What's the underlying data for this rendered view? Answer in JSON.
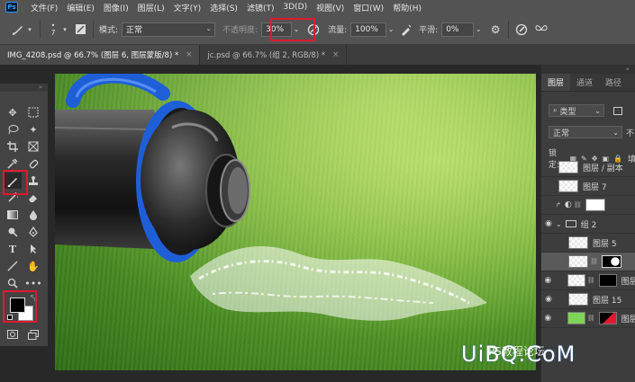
{
  "menubar": {
    "logo": "Ps",
    "items": [
      "文件(F)",
      "编辑(E)",
      "图像(I)",
      "图层(L)",
      "文字(Y)",
      "选择(S)",
      "滤镜(T)",
      "3D(D)",
      "视图(V)",
      "窗口(W)",
      "帮助(H)"
    ]
  },
  "options": {
    "brush_size": "7",
    "mode_label": "模式:",
    "mode_value": "正常",
    "opacity_label": "不透明度:",
    "opacity_value": "30%",
    "flow_label": "流量:",
    "flow_value": "100%",
    "smoothing_label": "平滑:",
    "smoothing_value": "0%"
  },
  "tabs": [
    {
      "title": "IMG_4208.psd @ 66.7% (图层 6, 图层蒙版/8) *",
      "close": "×"
    },
    {
      "title": "jc.psd @ 66.7% (组 2, RGB/8) *",
      "close": "×"
    }
  ],
  "toolbar": {
    "collapse": "»"
  },
  "panel": {
    "collapse": "»",
    "tabs": [
      "图层",
      "通道",
      "路径"
    ],
    "filter_value": "类型",
    "blend_value": "正常",
    "opacity_short": "不",
    "lock_label": "锁定:",
    "fill_short": "填",
    "layers": [
      {
        "name": "图层 / 副本"
      },
      {
        "name": "图层 7"
      },
      {
        "name": ""
      },
      {
        "name": "组 2"
      },
      {
        "name": "图层 5"
      },
      {
        "name": ""
      },
      {
        "name": "图层"
      },
      {
        "name": "图层 15"
      },
      {
        "name": "图层"
      }
    ]
  },
  "watermark": {
    "text": "UiBQ.CoM",
    "cn": "PS教程论坛"
  },
  "colors": {
    "accent_red": "#e0192f",
    "brand_blue": "#1e5fd8",
    "grass": "#5da32c"
  }
}
